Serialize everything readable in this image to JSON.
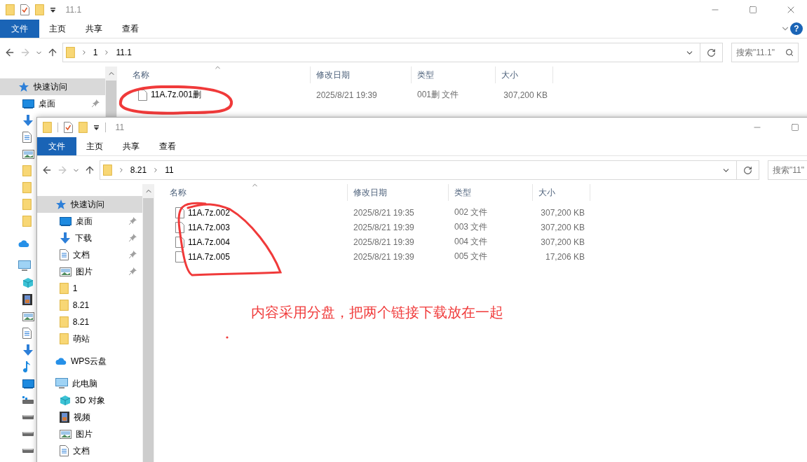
{
  "back_window": {
    "title": "11.1",
    "title_buttons": [
      {
        "kind": "minimize"
      },
      {
        "kind": "maximize"
      },
      {
        "kind": "close"
      }
    ],
    "help_button": {
      "label": "?"
    },
    "file_menu": "文件",
    "ribbon_tabs": [
      "主页",
      "共享",
      "查看"
    ],
    "breadcrumb": [
      "1",
      "11.1"
    ],
    "search": {
      "placeholder": "搜索\"11.1\"",
      "icon": true
    },
    "sidebar": [
      {
        "label": "快速访问",
        "kind": "star",
        "selected": true,
        "children": [
          {
            "label": "桌面",
            "kind": "desktop",
            "pinned": true
          },
          {
            "kind": "download"
          },
          {
            "kind": "document"
          },
          {
            "kind": "picture"
          },
          {
            "kind": "folder"
          },
          {
            "kind": "folder"
          },
          {
            "kind": "folder"
          },
          {
            "kind": "folder"
          }
        ]
      },
      {
        "kind": "cloud",
        "selected": false
      },
      {
        "kind": "pc",
        "selected": false,
        "children": [
          {
            "kind": "cube"
          },
          {
            "kind": "video"
          },
          {
            "kind": "picture"
          },
          {
            "kind": "document"
          },
          {
            "kind": "download"
          },
          {
            "kind": "music"
          },
          {
            "kind": "desktop"
          },
          {
            "kind": "netdrive"
          },
          {
            "kind": "drive"
          },
          {
            "kind": "drive"
          },
          {
            "kind": "drive"
          }
        ]
      }
    ],
    "columns": [
      "名称",
      "修改日期",
      "类型",
      "大小"
    ],
    "rows": [
      {
        "name": "11A.7z.001删",
        "date": "2025/8/21 19:39",
        "type": "001删 文件",
        "size": "307,200 KB"
      }
    ]
  },
  "front_window": {
    "title": "11",
    "title_buttons": [
      {
        "kind": "minimize"
      },
      {
        "kind": "maximize"
      }
    ],
    "file_menu": "文件",
    "ribbon_tabs": [
      "主页",
      "共享",
      "查看"
    ],
    "breadcrumb": [
      "8.21",
      "11"
    ],
    "search": {
      "placeholder": "搜索\"11\""
    },
    "sidebar": [
      {
        "label": "快速访问",
        "kind": "star",
        "selected": true,
        "children": [
          {
            "label": "桌面",
            "kind": "desktop",
            "pinned": true
          },
          {
            "label": "下载",
            "kind": "download",
            "pinned": true
          },
          {
            "label": "文档",
            "kind": "document",
            "pinned": true
          },
          {
            "label": "图片",
            "kind": "picture",
            "pinned": true
          },
          {
            "label": "1",
            "kind": "folder",
            "pinned": false
          },
          {
            "label": "8.21",
            "kind": "folder",
            "pinned": false
          },
          {
            "label": "8.21",
            "kind": "folder",
            "pinned": false
          },
          {
            "label": "萌站",
            "kind": "folder",
            "pinned": false
          }
        ]
      },
      {
        "label": "WPS云盘",
        "kind": "cloud",
        "selected": false
      },
      {
        "label": "此电脑",
        "kind": "pc",
        "selected": false,
        "children": [
          {
            "label": "3D 对象",
            "kind": "cube",
            "pinned": false
          },
          {
            "label": "视频",
            "kind": "video",
            "pinned": false
          },
          {
            "label": "图片",
            "kind": "picture",
            "pinned": false
          },
          {
            "label": "文档",
            "kind": "document",
            "pinned": false
          }
        ]
      }
    ],
    "columns": [
      "名称",
      "修改日期",
      "类型",
      "大小"
    ],
    "rows": [
      {
        "name": "11A.7z.002",
        "date": "2025/8/21 19:35",
        "type": "002 文件",
        "size": "307,200 KB"
      },
      {
        "name": "11A.7z.003",
        "date": "2025/8/21 19:39",
        "type": "003 文件",
        "size": "307,200 KB"
      },
      {
        "name": "11A.7z.004",
        "date": "2025/8/21 19:39",
        "type": "004 文件",
        "size": "307,200 KB"
      },
      {
        "name": "11A.7z.005",
        "date": "2025/8/21 19:39",
        "type": "005 文件",
        "size": "17,206 KB"
      }
    ]
  },
  "annotation": {
    "note": "内容采用分盘，把两个链接下载放在一起"
  }
}
